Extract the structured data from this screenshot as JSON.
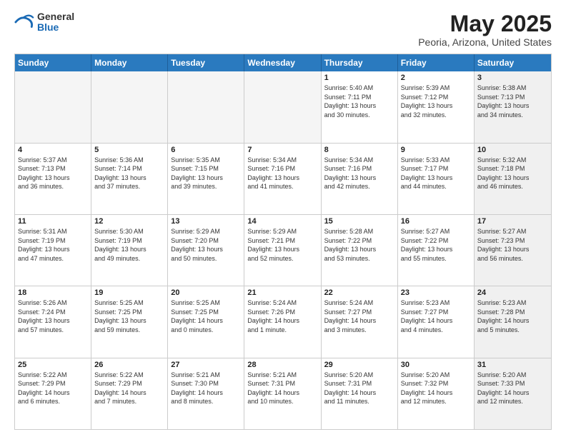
{
  "logo": {
    "general": "General",
    "blue": "Blue"
  },
  "header": {
    "title": "May 2025",
    "subtitle": "Peoria, Arizona, United States"
  },
  "calendar": {
    "days_of_week": [
      "Sunday",
      "Monday",
      "Tuesday",
      "Wednesday",
      "Thursday",
      "Friday",
      "Saturday"
    ],
    "rows": [
      [
        {
          "day": "",
          "info": "",
          "empty": true
        },
        {
          "day": "",
          "info": "",
          "empty": true
        },
        {
          "day": "",
          "info": "",
          "empty": true
        },
        {
          "day": "",
          "info": "",
          "empty": true
        },
        {
          "day": "1",
          "info": "Sunrise: 5:40 AM\nSunset: 7:11 PM\nDaylight: 13 hours\nand 30 minutes.",
          "empty": false
        },
        {
          "day": "2",
          "info": "Sunrise: 5:39 AM\nSunset: 7:12 PM\nDaylight: 13 hours\nand 32 minutes.",
          "empty": false
        },
        {
          "day": "3",
          "info": "Sunrise: 5:38 AM\nSunset: 7:13 PM\nDaylight: 13 hours\nand 34 minutes.",
          "empty": false,
          "shaded": true
        }
      ],
      [
        {
          "day": "4",
          "info": "Sunrise: 5:37 AM\nSunset: 7:13 PM\nDaylight: 13 hours\nand 36 minutes.",
          "empty": false
        },
        {
          "day": "5",
          "info": "Sunrise: 5:36 AM\nSunset: 7:14 PM\nDaylight: 13 hours\nand 37 minutes.",
          "empty": false
        },
        {
          "day": "6",
          "info": "Sunrise: 5:35 AM\nSunset: 7:15 PM\nDaylight: 13 hours\nand 39 minutes.",
          "empty": false
        },
        {
          "day": "7",
          "info": "Sunrise: 5:34 AM\nSunset: 7:16 PM\nDaylight: 13 hours\nand 41 minutes.",
          "empty": false
        },
        {
          "day": "8",
          "info": "Sunrise: 5:34 AM\nSunset: 7:16 PM\nDaylight: 13 hours\nand 42 minutes.",
          "empty": false
        },
        {
          "day": "9",
          "info": "Sunrise: 5:33 AM\nSunset: 7:17 PM\nDaylight: 13 hours\nand 44 minutes.",
          "empty": false
        },
        {
          "day": "10",
          "info": "Sunrise: 5:32 AM\nSunset: 7:18 PM\nDaylight: 13 hours\nand 46 minutes.",
          "empty": false,
          "shaded": true
        }
      ],
      [
        {
          "day": "11",
          "info": "Sunrise: 5:31 AM\nSunset: 7:19 PM\nDaylight: 13 hours\nand 47 minutes.",
          "empty": false
        },
        {
          "day": "12",
          "info": "Sunrise: 5:30 AM\nSunset: 7:19 PM\nDaylight: 13 hours\nand 49 minutes.",
          "empty": false
        },
        {
          "day": "13",
          "info": "Sunrise: 5:29 AM\nSunset: 7:20 PM\nDaylight: 13 hours\nand 50 minutes.",
          "empty": false
        },
        {
          "day": "14",
          "info": "Sunrise: 5:29 AM\nSunset: 7:21 PM\nDaylight: 13 hours\nand 52 minutes.",
          "empty": false
        },
        {
          "day": "15",
          "info": "Sunrise: 5:28 AM\nSunset: 7:22 PM\nDaylight: 13 hours\nand 53 minutes.",
          "empty": false
        },
        {
          "day": "16",
          "info": "Sunrise: 5:27 AM\nSunset: 7:22 PM\nDaylight: 13 hours\nand 55 minutes.",
          "empty": false
        },
        {
          "day": "17",
          "info": "Sunrise: 5:27 AM\nSunset: 7:23 PM\nDaylight: 13 hours\nand 56 minutes.",
          "empty": false,
          "shaded": true
        }
      ],
      [
        {
          "day": "18",
          "info": "Sunrise: 5:26 AM\nSunset: 7:24 PM\nDaylight: 13 hours\nand 57 minutes.",
          "empty": false
        },
        {
          "day": "19",
          "info": "Sunrise: 5:25 AM\nSunset: 7:25 PM\nDaylight: 13 hours\nand 59 minutes.",
          "empty": false
        },
        {
          "day": "20",
          "info": "Sunrise: 5:25 AM\nSunset: 7:25 PM\nDaylight: 14 hours\nand 0 minutes.",
          "empty": false
        },
        {
          "day": "21",
          "info": "Sunrise: 5:24 AM\nSunset: 7:26 PM\nDaylight: 14 hours\nand 1 minute.",
          "empty": false
        },
        {
          "day": "22",
          "info": "Sunrise: 5:24 AM\nSunset: 7:27 PM\nDaylight: 14 hours\nand 3 minutes.",
          "empty": false
        },
        {
          "day": "23",
          "info": "Sunrise: 5:23 AM\nSunset: 7:27 PM\nDaylight: 14 hours\nand 4 minutes.",
          "empty": false
        },
        {
          "day": "24",
          "info": "Sunrise: 5:23 AM\nSunset: 7:28 PM\nDaylight: 14 hours\nand 5 minutes.",
          "empty": false,
          "shaded": true
        }
      ],
      [
        {
          "day": "25",
          "info": "Sunrise: 5:22 AM\nSunset: 7:29 PM\nDaylight: 14 hours\nand 6 minutes.",
          "empty": false
        },
        {
          "day": "26",
          "info": "Sunrise: 5:22 AM\nSunset: 7:29 PM\nDaylight: 14 hours\nand 7 minutes.",
          "empty": false
        },
        {
          "day": "27",
          "info": "Sunrise: 5:21 AM\nSunset: 7:30 PM\nDaylight: 14 hours\nand 8 minutes.",
          "empty": false
        },
        {
          "day": "28",
          "info": "Sunrise: 5:21 AM\nSunset: 7:31 PM\nDaylight: 14 hours\nand 10 minutes.",
          "empty": false
        },
        {
          "day": "29",
          "info": "Sunrise: 5:20 AM\nSunset: 7:31 PM\nDaylight: 14 hours\nand 11 minutes.",
          "empty": false
        },
        {
          "day": "30",
          "info": "Sunrise: 5:20 AM\nSunset: 7:32 PM\nDaylight: 14 hours\nand 12 minutes.",
          "empty": false
        },
        {
          "day": "31",
          "info": "Sunrise: 5:20 AM\nSunset: 7:33 PM\nDaylight: 14 hours\nand 12 minutes.",
          "empty": false,
          "shaded": true
        }
      ]
    ]
  }
}
